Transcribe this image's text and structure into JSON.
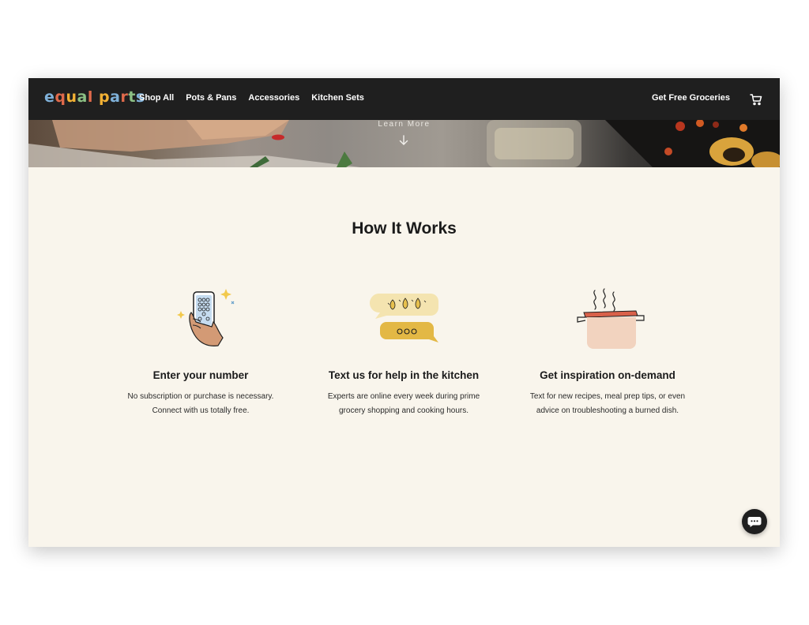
{
  "brand": {
    "logo_letters": [
      "e",
      "q",
      "u",
      "a",
      "l",
      " ",
      "p",
      "a",
      "r",
      "t",
      "s"
    ],
    "logo_colors": [
      "#7fb1d9",
      "#e06a4b",
      "#f2b134",
      "#8cc084",
      "#e06a4b",
      "#ffffff",
      "#f2b134",
      "#7fb1d9",
      "#e06a4b",
      "#8cc084",
      "#7fb1d9"
    ]
  },
  "nav": {
    "items": [
      "Shop All",
      "Pots & Pans",
      "Accessories",
      "Kitchen Sets"
    ],
    "cta": "Get Free Groceries",
    "cart_icon": "shopping-cart-icon"
  },
  "hero": {
    "learn_more": "Learn More",
    "arrow_icon": "arrow-down-icon"
  },
  "how_it_works": {
    "title": "How It Works",
    "features": [
      {
        "icon": "phone-in-hand-icon",
        "title": "Enter your number",
        "description": "No subscription or purchase is necessary. Connect with us totally free."
      },
      {
        "icon": "chat-bubbles-icon",
        "title": "Text us for help in the kitchen",
        "description": "Experts are online every week during prime grocery shopping and cooking hours."
      },
      {
        "icon": "cooking-pot-icon",
        "title": "Get inspiration on-demand",
        "description": "Text for new recipes, meal prep tips, or even advice on troubleshooting a burned dish."
      }
    ]
  },
  "chat": {
    "icon": "chat-icon"
  },
  "colors": {
    "header_bg": "#1f1f1f",
    "content_bg": "#f9f5ec",
    "accent_yellow": "#e7c04e",
    "accent_peach": "#f2d3bf",
    "accent_red": "#d9614a"
  }
}
